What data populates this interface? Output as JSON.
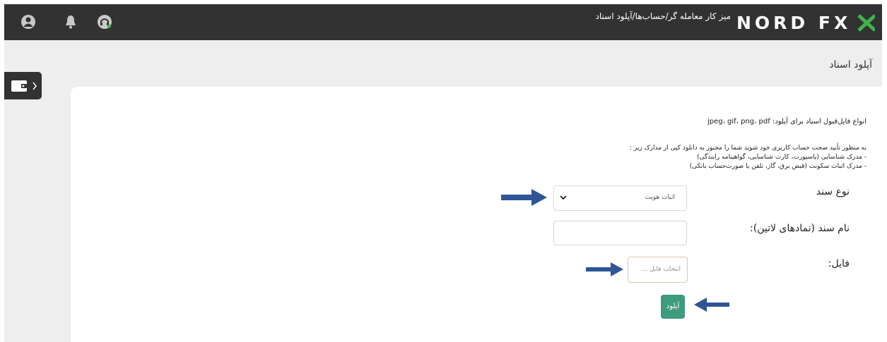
{
  "brand": {
    "logo_text": "NORD FX",
    "accent": "#2e8b57"
  },
  "header": {
    "breadcrumb": "میز کار معامله گر/حساب‌ها/آپلود اسناد",
    "icons": [
      "user-circle-icon",
      "bell-icon",
      "headset-icon"
    ]
  },
  "sidebar": {
    "wallet_icon": "wallet-icon",
    "expand_icon": "chevron-right-icon"
  },
  "page": {
    "title": "آپلود اسناد"
  },
  "info": {
    "formats": "انواع فایل‌قبول اسناد برای آپلود: jpeg، gif، png، pdf",
    "intro": "به منظور تأیید صحت حساب کاربری خود شوید شما را مجبور به دانلود کپی از مدارک زیر :",
    "item1": "- مدرک شناسایی (پاسپورت، کارت شناسایی، گواهینامه رانندگی)",
    "item2": "- مدرک اثبات سکونت (قبض برق، گاز، تلفن یا صورت‌حساب بانکی)"
  },
  "form": {
    "doc_type_label": "نوع سند",
    "doc_type_value": "اثبات هویت",
    "doc_name_label": "نام سند (نمادهای لاتین):",
    "doc_name_value": "",
    "file_label": "فایل:",
    "file_button": "انتخاب فایل ...",
    "upload_button": "آپلود"
  },
  "colors": {
    "topbar": "#323232",
    "arrow": "#2f5597",
    "upload": "#3c9c7c",
    "background": "#eeeeee"
  }
}
